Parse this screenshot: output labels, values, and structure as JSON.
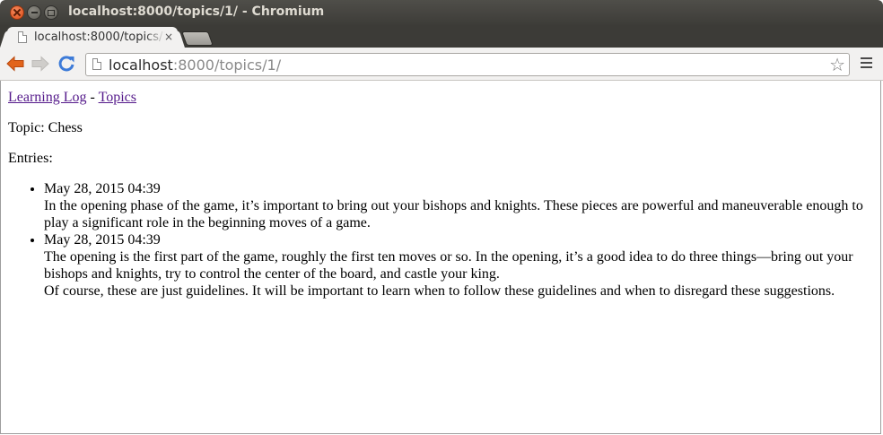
{
  "window": {
    "title": "localhost:8000/topics/1/ - Chromium"
  },
  "tab": {
    "title": "localhost:8000/topics/1/",
    "close_glyph": "×"
  },
  "toolbar": {
    "url_host": "localhost",
    "url_rest": ":8000/topics/1/",
    "icons": [
      "back-arrow-icon",
      "forward-arrow-icon",
      "reload-icon",
      "page-icon",
      "bookmark-star-icon",
      "menu-icon"
    ],
    "back_color": "#e2641b",
    "reload_color": "#3d7bd8"
  },
  "page": {
    "nav": {
      "home_link": "Learning Log",
      "separator": " - ",
      "topics_link": "Topics"
    },
    "topic_line": "Topic: Chess",
    "entries_label": "Entries:",
    "entries": [
      {
        "date": "May 28, 2015 04:39",
        "paragraphs": [
          "In the opening phase of the game, it’s important to bring out your bishops and knights. These pieces are powerful and maneuverable enough to play a significant role in the beginning moves of a game."
        ]
      },
      {
        "date": "May 28, 2015 04:39",
        "paragraphs": [
          "The opening is the first part of the game, roughly the first ten moves or so. In the opening, it’s a good idea to do three things—bring out your bishops and knights, try to control the center of the board, and castle your king.",
          "Of course, these are just guidelines. It will be important to learn when to follow these guidelines and when to disregard these suggestions."
        ]
      }
    ]
  }
}
